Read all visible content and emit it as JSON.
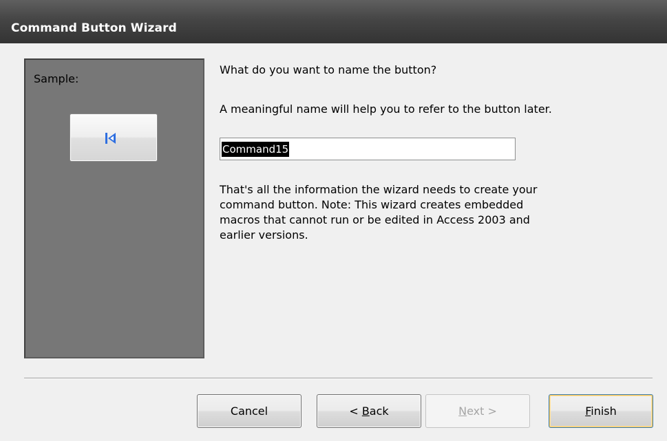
{
  "window": {
    "title": "Command Button Wizard"
  },
  "sample": {
    "label": "Sample:",
    "button_icon": "first-record-icon"
  },
  "main": {
    "prompt": "What do you want to name the button?",
    "hint": "A meaningful name will help you to refer to the button later.",
    "name_input_value": "Command15",
    "info_lines": [
      "That's all the information the wizard needs to create your",
      "command button. Note: This wizard creates embedded",
      "macros that cannot run or be edited in Access 2003 and",
      "earlier versions."
    ]
  },
  "buttons": {
    "cancel": {
      "label": "Cancel"
    },
    "back": {
      "prefix": "< ",
      "accel": "B",
      "rest": "ack"
    },
    "next": {
      "accel": "N",
      "rest": "ext >"
    },
    "finish": {
      "accel": "F",
      "rest": "inish"
    }
  },
  "colors": {
    "titlebar": "#454545",
    "sample_panel": "#777777",
    "dialog_background": "#f0f0f0",
    "icon_blue": "#2f6fe0",
    "finish_focus_ring": "#f7c55a"
  }
}
